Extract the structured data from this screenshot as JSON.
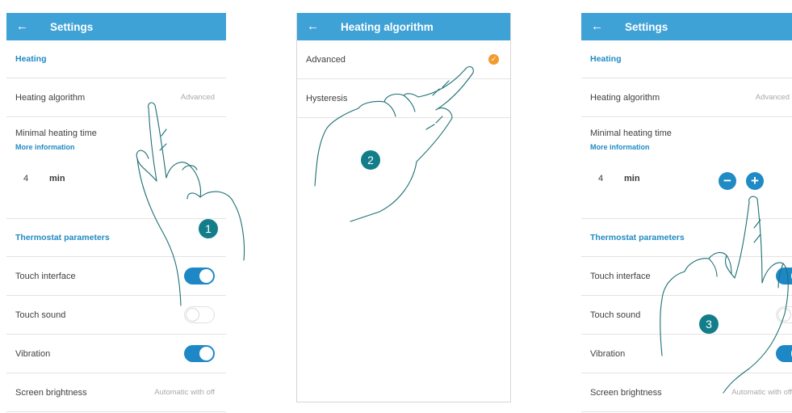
{
  "screens": [
    {
      "title": "Settings",
      "section_heating": "Heating",
      "algorithm_label": "Heating algorithm",
      "algorithm_value": "Advanced",
      "min_time_label": "Minimal heating time",
      "more_info": "More information",
      "min_time_value": "4",
      "min_time_unit": "min",
      "section_thermostat": "Thermostat parameters",
      "touch_interface": "Touch interface",
      "touch_sound": "Touch sound",
      "vibration": "Vibration",
      "screen_brightness": "Screen brightness",
      "screen_brightness_value": "Automatic with off"
    },
    {
      "title": "Heating algorithm",
      "options": [
        "Advanced",
        "Hysteresis"
      ],
      "selected": "Advanced"
    },
    {
      "title": "Settings",
      "section_heating": "Heating",
      "algorithm_label": "Heating algorithm",
      "algorithm_value": "Advanced",
      "min_time_label": "Minimal heating time",
      "more_info": "More information",
      "min_time_value": "4",
      "min_time_unit": "min",
      "minus": "−",
      "plus": "+",
      "section_thermostat": "Thermostat parameters",
      "touch_interface": "Touch interface",
      "touch_sound": "Touch sound",
      "vibration": "Vibration",
      "screen_brightness": "Screen brightness",
      "screen_brightness_value": "Automatic with off"
    }
  ],
  "toggles": {
    "touch_interface": true,
    "touch_sound": false,
    "vibration": true
  },
  "steps": [
    "1",
    "2",
    "3"
  ],
  "colors": {
    "appbar": "#3fa2d6",
    "accent": "#1f8ac4",
    "check": "#f39a2c",
    "badge": "#137e8a"
  },
  "icons": {
    "back": "←",
    "check": "✓"
  }
}
